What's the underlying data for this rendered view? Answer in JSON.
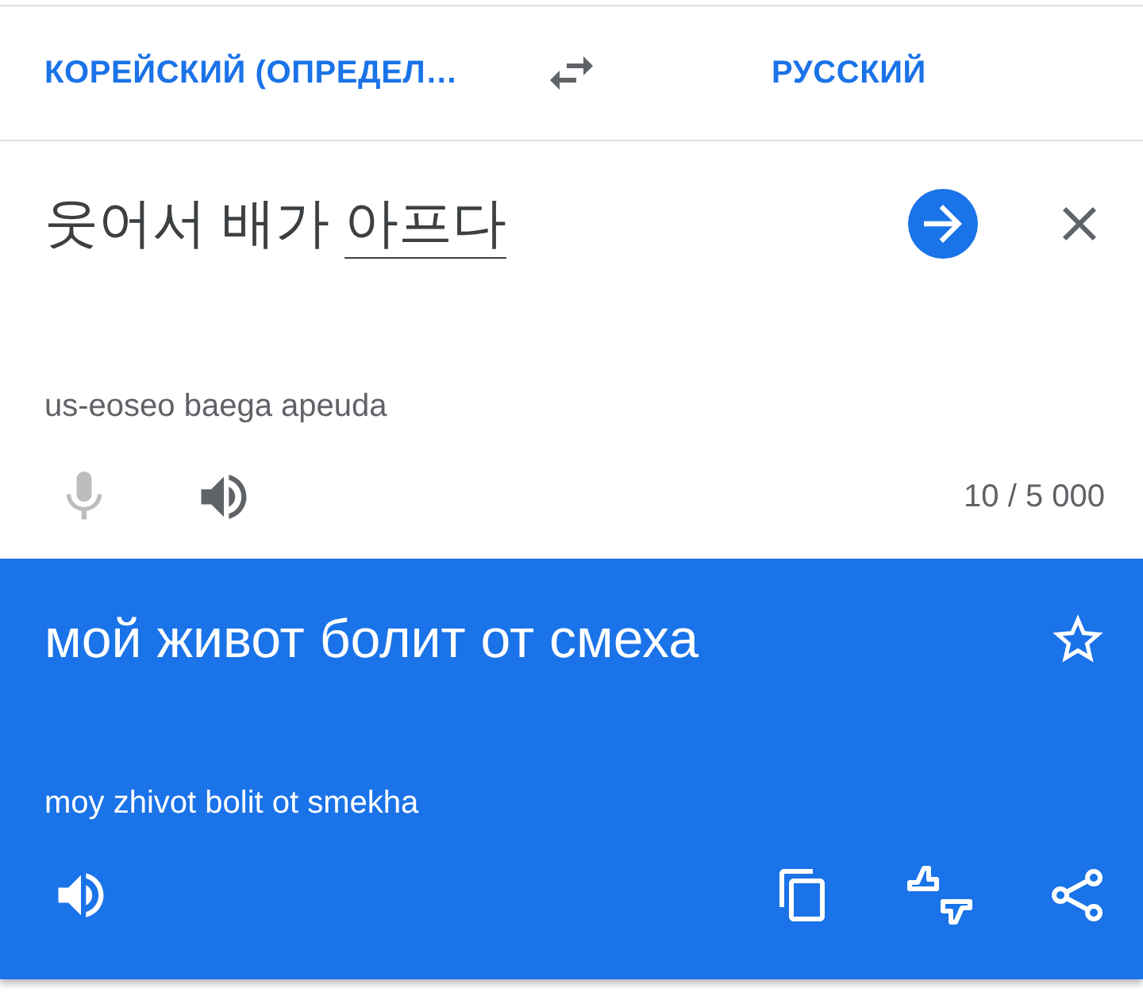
{
  "languages": {
    "source": "КОРЕЙСКИЙ (ОПРЕДЕЛ…",
    "target": "РУССКИЙ"
  },
  "source": {
    "text_parts": [
      {
        "text": "웃어서 배가 ",
        "underlined": false
      },
      {
        "text": "아프다",
        "underlined": true
      }
    ],
    "transliteration": "us-eoseo baega apeuda",
    "mic_disabled": true,
    "char_count": "10 / 5 000"
  },
  "result": {
    "translation": "мой живот болит от смеха",
    "starred": false,
    "transliteration": "moy zhivot bolit ot smekha"
  }
}
